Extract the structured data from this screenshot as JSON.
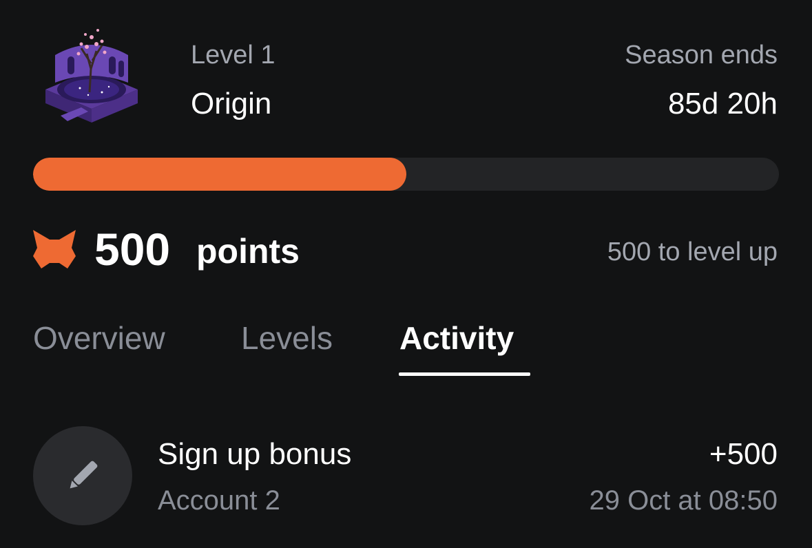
{
  "header": {
    "level_label": "Level 1",
    "level_name": "Origin",
    "season_label": "Season ends",
    "season_value": "85d 20h",
    "level_art_icon": "purple-garden-tree-icon"
  },
  "progress": {
    "percent": 50,
    "fill_color": "#ee6a33",
    "track_color": "#232426"
  },
  "points": {
    "icon": "fox-icon",
    "value": "500",
    "unit": "points",
    "to_level_up": "500 to level up"
  },
  "tabs": [
    {
      "label": "Overview",
      "active": false
    },
    {
      "label": "Levels",
      "active": false
    },
    {
      "label": "Activity",
      "active": true
    }
  ],
  "activity": [
    {
      "icon": "pencil-icon",
      "title": "Sign up bonus",
      "account": "Account 2",
      "amount": "+500",
      "date": "29 Oct at 08:50"
    }
  ],
  "colors": {
    "background": "#121314",
    "accent": "#ee6a33",
    "muted_text": "#a3a7b0"
  }
}
